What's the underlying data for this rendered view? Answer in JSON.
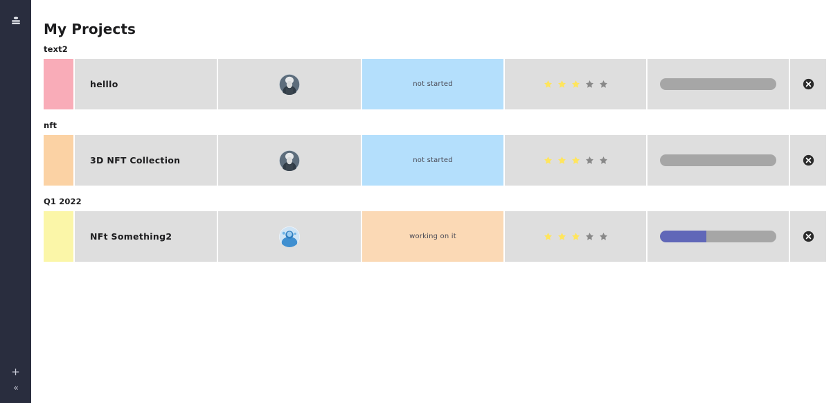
{
  "sidebar": {
    "top_icon": "database-icon",
    "add_label": "+",
    "collapse_label": "«"
  },
  "header": {
    "title": "My Projects"
  },
  "colors": {
    "sidebar_bg": "#292d3e",
    "cell_bg": "#dedede",
    "status_not_started_bg": "#b4dffc",
    "status_working_bg": "#fbd9b5",
    "progress_fill": "#6067b8",
    "progress_track": "#a6a6a6",
    "star_active": "#ffe55c",
    "star_inactive": "#888888"
  },
  "groups": [
    {
      "title": "text2",
      "rows": [
        {
          "color": "#f9acb8",
          "name": "helllo",
          "avatar": "person-avatar-gray",
          "status": "not started",
          "status_bg": "#b4dffc",
          "stars_filled": 3,
          "stars_total": 5,
          "progress": 0,
          "delete": "close-circle-icon"
        }
      ]
    },
    {
      "title": "nft",
      "rows": [
        {
          "color": "#fbd2a4",
          "name": "3D NFT Collection",
          "avatar": "person-avatar-gray",
          "status": "not started",
          "status_bg": "#b4dffc",
          "stars_filled": 3,
          "stars_total": 5,
          "progress": 0,
          "delete": "close-circle-icon"
        }
      ]
    },
    {
      "title": "Q1 2022",
      "rows": [
        {
          "color": "#fbf6a8",
          "name": "NFt Something2",
          "avatar": "person-avatar-blue",
          "status": "working on it",
          "status_bg": "#fbd9b5",
          "stars_filled": 3,
          "stars_total": 5,
          "progress": 40,
          "delete": "close-circle-icon"
        }
      ]
    }
  ]
}
